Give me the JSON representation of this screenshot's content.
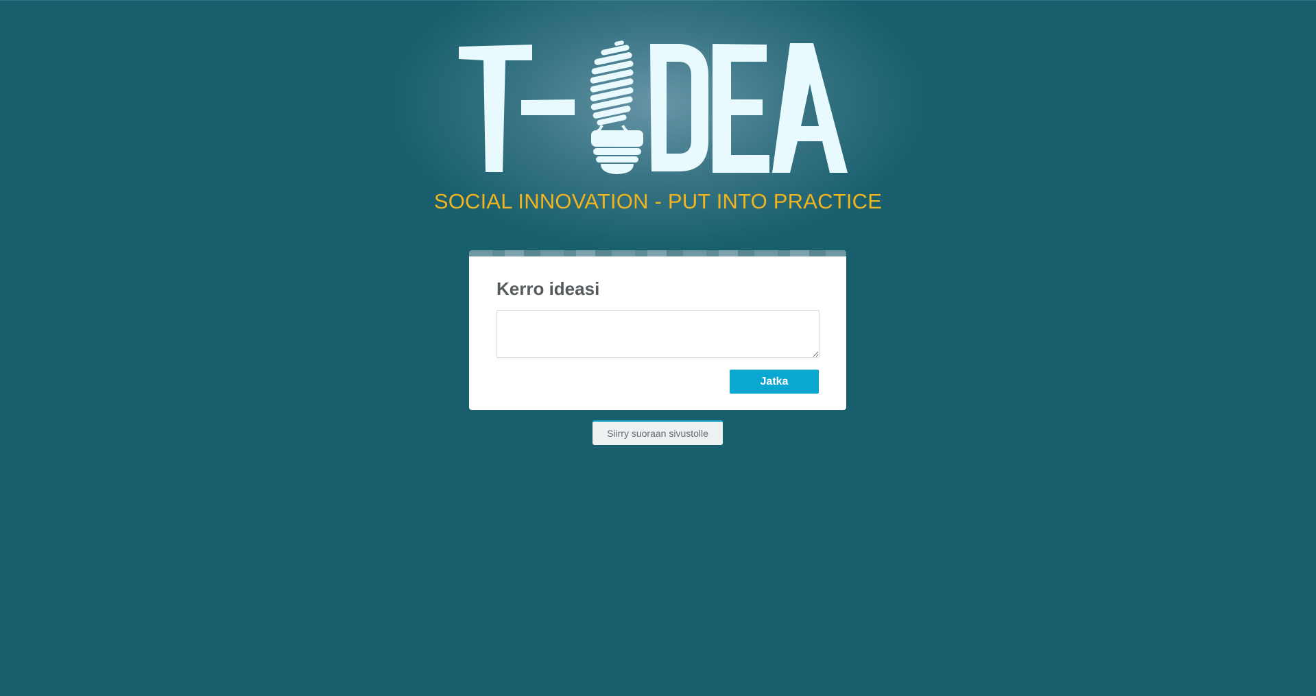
{
  "app": {
    "name": "T-IDEA",
    "tagline": "SOCIAL INNOVATION - PUT INTO PRACTICE"
  },
  "logo": {
    "icon": "lightbulb-icon",
    "text_color": "#e8fafd"
  },
  "card": {
    "title": "Kerro ideasi",
    "input_value": "",
    "input_placeholder": "",
    "continue_label": "Jatka"
  },
  "skip_label": "Siirry suoraan sivustolle",
  "colors": {
    "background": "#185e6c",
    "tagline": "#f2b51e",
    "primary_button": "#0aa7d0",
    "card": "#ffffff"
  }
}
